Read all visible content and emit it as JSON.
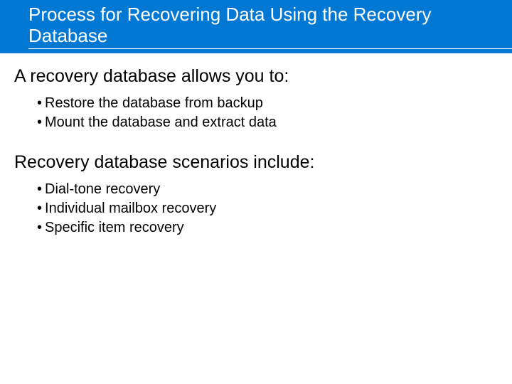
{
  "title": "Process for Recovering Data Using the Recovery Database",
  "section1": {
    "lead": "A recovery database allows you to:",
    "items": [
      "Restore the database from backup",
      "Mount the database and extract data"
    ]
  },
  "section2": {
    "lead": "Recovery database scenarios include:",
    "items": [
      "Dial-tone recovery",
      "Individual mailbox recovery",
      "Specific item recovery"
    ]
  },
  "bullet_char": "•"
}
